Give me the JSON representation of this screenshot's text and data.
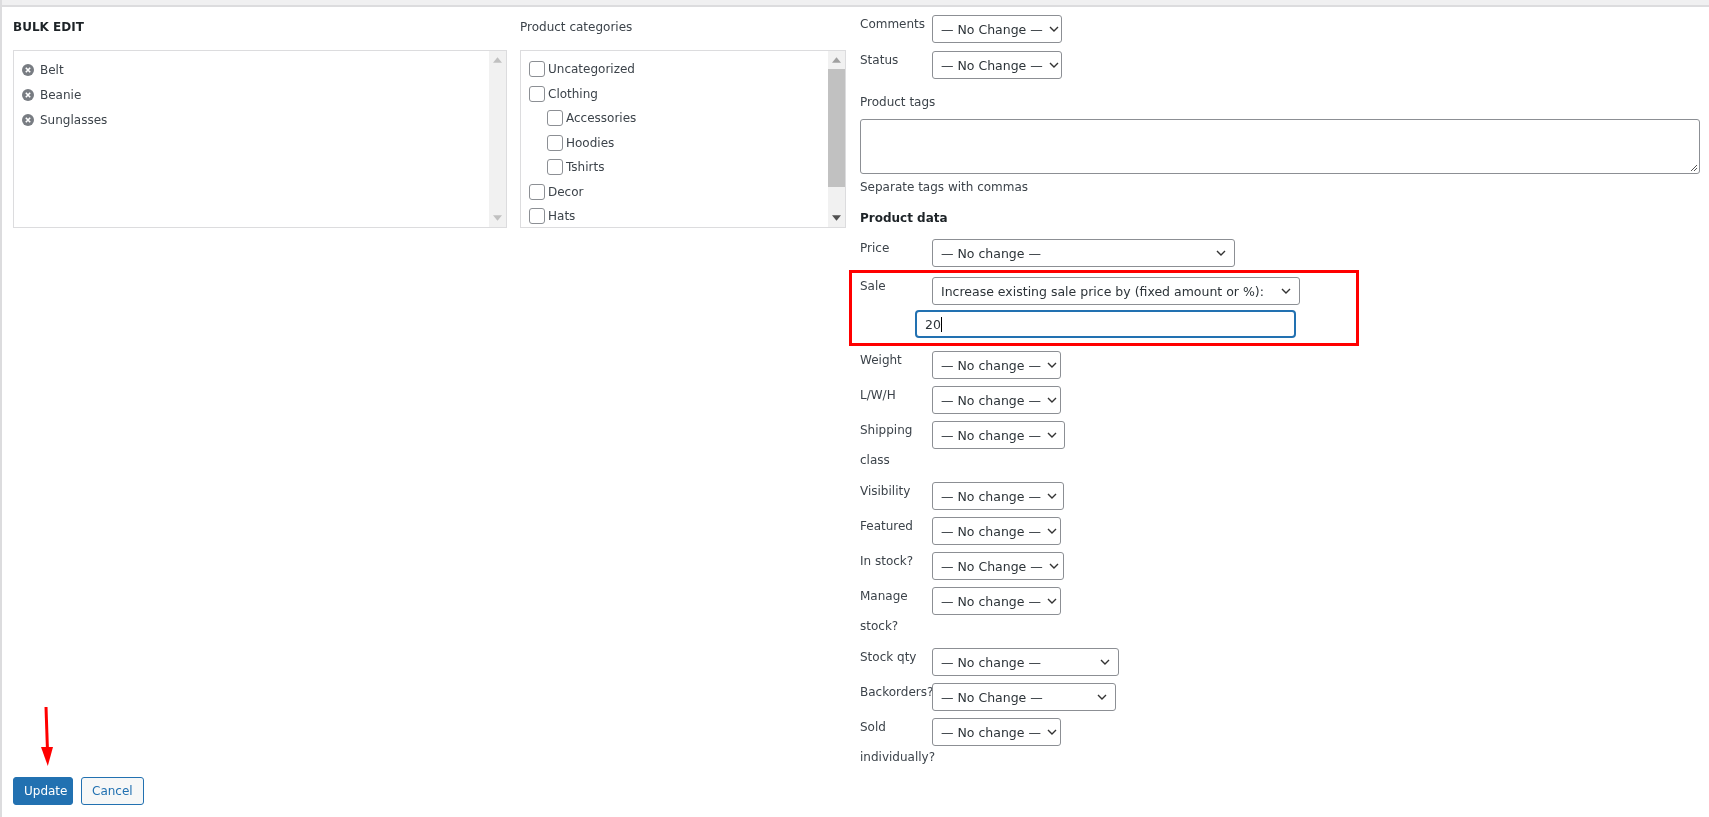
{
  "bulk_edit": {
    "title": "BULK EDIT",
    "items": [
      {
        "label": "Belt"
      },
      {
        "label": "Beanie"
      },
      {
        "label": "Sunglasses"
      }
    ]
  },
  "categories": {
    "title": "Product categories",
    "items": [
      {
        "label": "Uncategorized",
        "checked": false
      },
      {
        "label": "Clothing",
        "checked": false,
        "children": [
          {
            "label": "Accessories",
            "checked": false
          },
          {
            "label": "Hoodies",
            "checked": false
          },
          {
            "label": "Tshirts",
            "checked": false
          }
        ]
      },
      {
        "label": "Decor",
        "checked": false
      },
      {
        "label": "Hats",
        "checked": false
      }
    ]
  },
  "top_fields": [
    {
      "label": "Comments",
      "value": "— No Change —"
    },
    {
      "label": "Status",
      "value": "— No Change —"
    }
  ],
  "tags": {
    "label": "Product tags",
    "hint": "Separate tags with commas"
  },
  "product_data": {
    "title": "Product data",
    "fields": [
      {
        "label": "Price",
        "value": "— No change —"
      },
      {
        "label": "Sale",
        "value": "Increase existing sale price by (fixed amount or %):",
        "input": "20",
        "highlighted": true
      },
      {
        "label": "Weight",
        "value": "— No change —"
      },
      {
        "label": "L/W/H",
        "value": "— No change —"
      },
      {
        "label": "Shipping class",
        "value": "— No change —"
      },
      {
        "label": "Visibility",
        "value": "— No change —"
      },
      {
        "label": "Featured",
        "value": "— No change —"
      },
      {
        "label": "In stock?",
        "value": "— No Change —"
      },
      {
        "label": "Manage stock?",
        "value": "— No change —"
      },
      {
        "label": "Stock qty",
        "value": "— No change —"
      },
      {
        "label": "Backorders?",
        "value": "— No Change —"
      },
      {
        "label": "Sold individually?",
        "value": "— No change —"
      }
    ]
  },
  "buttons": [
    {
      "label": "Update",
      "kind": "primary"
    },
    {
      "label": "Cancel",
      "kind": "secondary"
    }
  ]
}
